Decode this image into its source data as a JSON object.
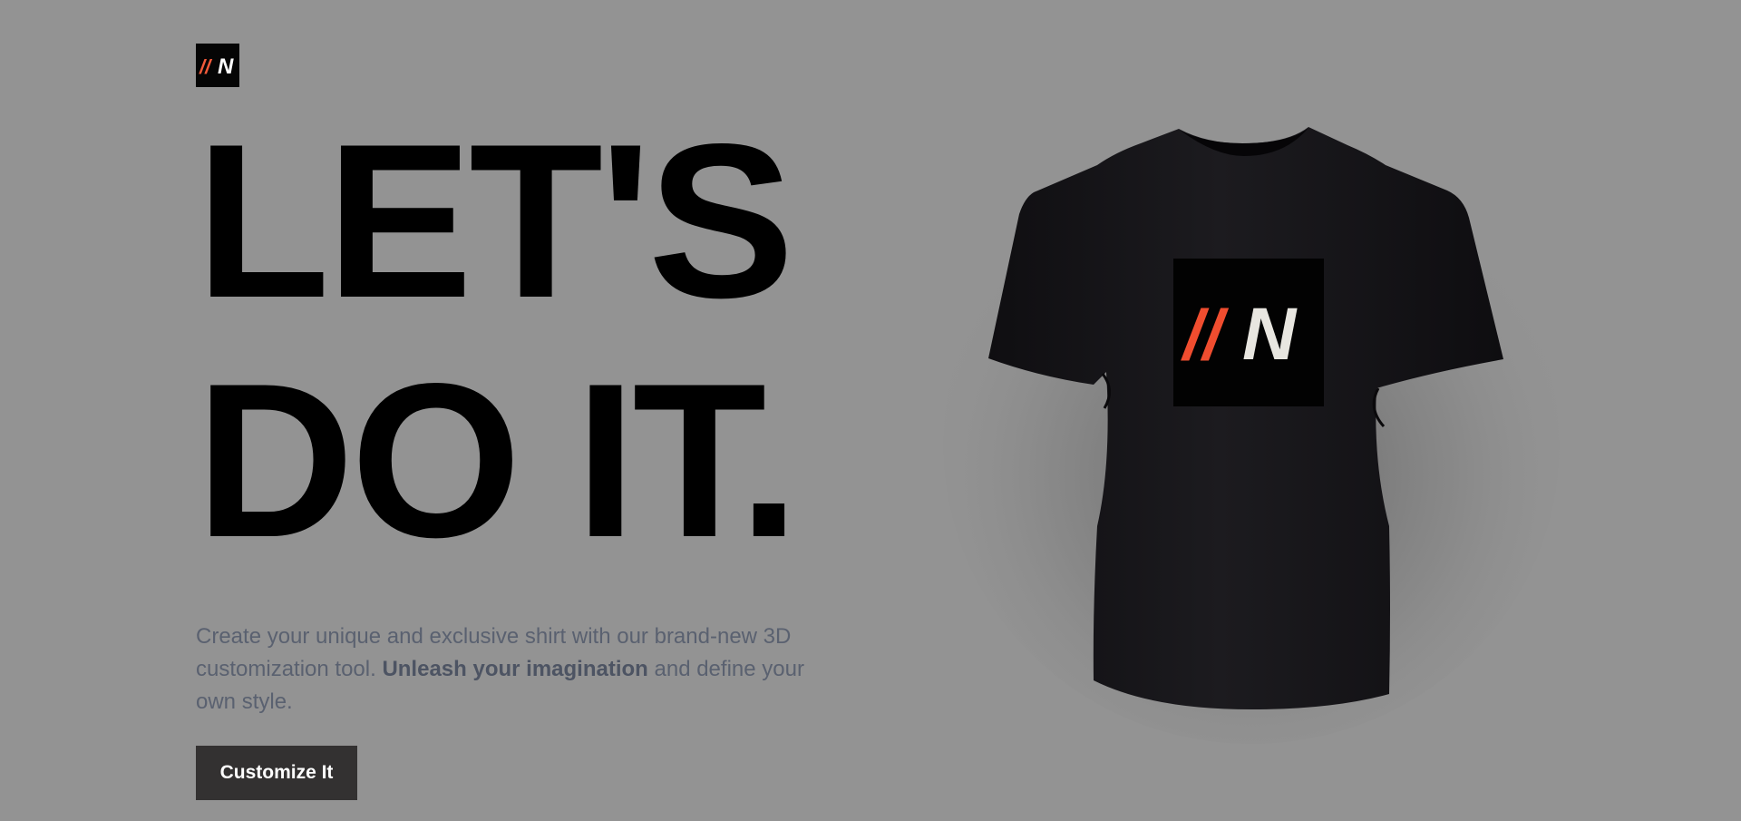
{
  "brand": {
    "logo_slashes": "//",
    "logo_letter": "N",
    "logo_slash_color": "#f25a3a",
    "logo_letter_color": "#ffffff"
  },
  "hero": {
    "headline_line1": "LET'S",
    "headline_line2": "DO IT.",
    "intro_part1": "Create your unique and exclusive shirt with our brand-new 3D customization tool. ",
    "intro_bold": "Unleash your imagination",
    "intro_part2": " and define your own style.",
    "cta_label": "Customize It"
  },
  "product": {
    "shirt_color": "#151417",
    "decal_bg": "#020202",
    "decal_slash_color": "#f04d2f",
    "decal_letter_color": "#e8e6e0",
    "decal_slashes": "//",
    "decal_letter": "N"
  },
  "colors": {
    "background": "#939393",
    "button_bg": "#333131",
    "text_muted": "#5a6170"
  }
}
